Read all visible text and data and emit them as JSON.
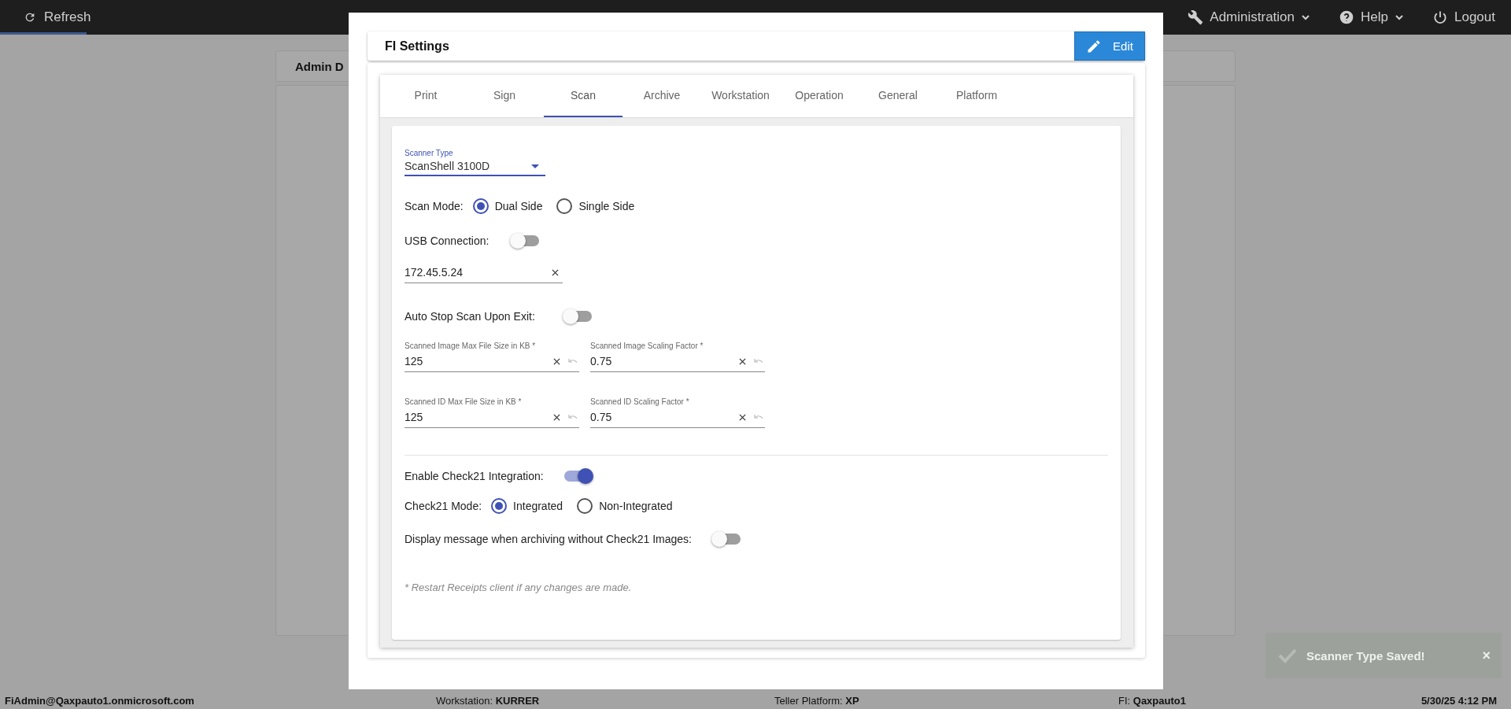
{
  "top_bar": {
    "refresh": "Refresh",
    "menus": [
      {
        "label": "Administration",
        "kind": "wrench"
      },
      {
        "label": "Help",
        "kind": "help"
      }
    ],
    "logout": "Logout"
  },
  "background": {
    "tab_label": "Admin D"
  },
  "dialog": {
    "title": "FI Settings",
    "edit_button": "Edit",
    "tabs": [
      {
        "label": "Print",
        "selected": false
      },
      {
        "label": "Sign",
        "selected": false
      },
      {
        "label": "Scan",
        "selected": true
      },
      {
        "label": "Archive",
        "selected": false
      },
      {
        "label": "Workstation",
        "selected": false
      },
      {
        "label": "Operation",
        "selected": false
      },
      {
        "label": "General",
        "selected": false
      },
      {
        "label": "Platform",
        "selected": false
      }
    ],
    "scanner_type": {
      "label": "Scanner Type",
      "value": "ScanShell 3100D"
    },
    "scan_mode": {
      "label": "Scan Mode:",
      "options": [
        {
          "label": "Dual Side",
          "selected": true
        },
        {
          "label": "Single Side",
          "selected": false
        }
      ]
    },
    "usb_connection": {
      "label": "USB Connection:",
      "on": false
    },
    "ip_field": {
      "value": "172.45.5.24"
    },
    "auto_stop": {
      "label": "Auto Stop Scan Upon Exit:",
      "on": false
    },
    "size_rows": [
      [
        {
          "label": "Scanned Image Max File Size in KB *",
          "value": "125"
        },
        {
          "label": "Scanned Image Scaling Factor *",
          "value": "0.75"
        }
      ],
      [
        {
          "label": "Scanned ID Max File Size in KB *",
          "value": "125"
        },
        {
          "label": "Scanned ID Scaling Factor *",
          "value": "0.75"
        }
      ]
    ],
    "check21": {
      "label": "Enable Check21 Integration:",
      "on": true
    },
    "check21_mode": {
      "label": "Check21 Mode:",
      "options": [
        {
          "label": "Integrated",
          "selected": true
        },
        {
          "label": "Non-Integrated",
          "selected": false
        }
      ]
    },
    "display_message": {
      "label": "Display message when archiving without Check21 Images:",
      "on": false
    },
    "note": "* Restart Receipts client if any changes are made."
  },
  "toast": {
    "message": "Scanner Type Saved!",
    "close": "×"
  },
  "status_bar": {
    "user": "FiAdmin@Qaxpauto1.onmicrosoft.com",
    "items": [
      "Workstation: **KURRER**",
      "Teller Platform: **XP**",
      "FI: **Qaxpauto1**"
    ],
    "datetime": "5/30/25 4:12 PM"
  }
}
